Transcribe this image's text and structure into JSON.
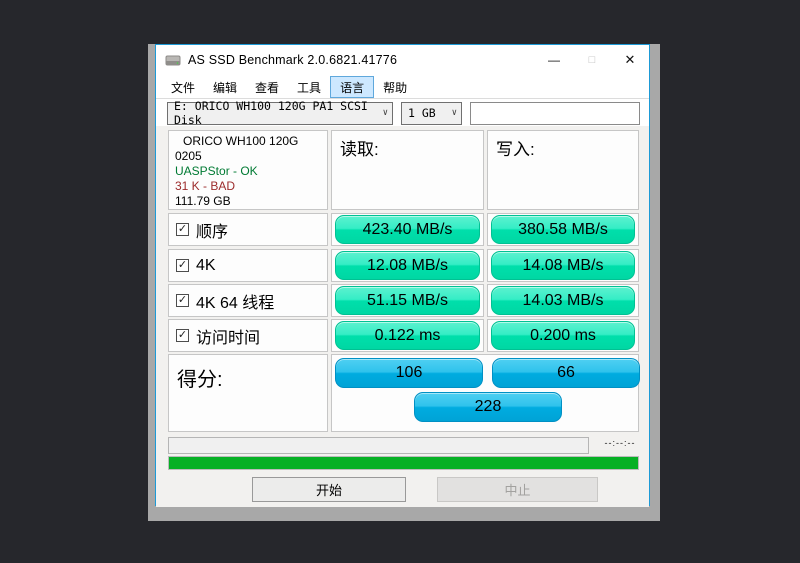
{
  "window": {
    "title": "AS SSD Benchmark 2.0.6821.41776"
  },
  "icons": {
    "minimize": "—",
    "maximize": "□",
    "close": "✕",
    "chevron_down": "∨",
    "check": "✓"
  },
  "menu": {
    "items": [
      "文件",
      "编辑",
      "查看",
      "工具",
      "语言",
      "帮助"
    ],
    "active": "语言"
  },
  "toolbar": {
    "drive_selected": "E: ORICO WH100 120G PA1 SCSI Disk",
    "size_selected": "1 GB",
    "input_value": ""
  },
  "info": {
    "model": "ORICO WH100 120G",
    "firmware": "0205",
    "driver_status": "UASPStor - OK",
    "alignment_status": "31 K - BAD",
    "capacity": "111.79 GB"
  },
  "columns": {
    "read": "读取:",
    "write": "写入:"
  },
  "rows": [
    {
      "label": "顺序",
      "checked": true,
      "read": "423.40 MB/s",
      "write": "380.58 MB/s"
    },
    {
      "label": "4K",
      "checked": true,
      "read": "12.08 MB/s",
      "write": "14.08 MB/s"
    },
    {
      "label": "4K 64 线程",
      "checked": true,
      "read": "51.15 MB/s",
      "write": "14.03 MB/s"
    },
    {
      "label": "访问时间",
      "checked": true,
      "read": "0.122 ms",
      "write": "0.200 ms"
    }
  ],
  "score": {
    "label": "得分:",
    "read_score": "106",
    "write_score": "66",
    "total_score": "228"
  },
  "status": {
    "time_remaining": "--:--:--",
    "progress_percent": 100
  },
  "buttons": {
    "start": "开始",
    "abort": "中止"
  },
  "colors": {
    "value_pill": "#00dfab",
    "score_pill": "#00ace0",
    "progress_green": "#06b025",
    "driver_ok_green": "#007a33",
    "alignment_bad_red": "#9c2b2b",
    "window_border_blue": "#1d9ad6"
  }
}
